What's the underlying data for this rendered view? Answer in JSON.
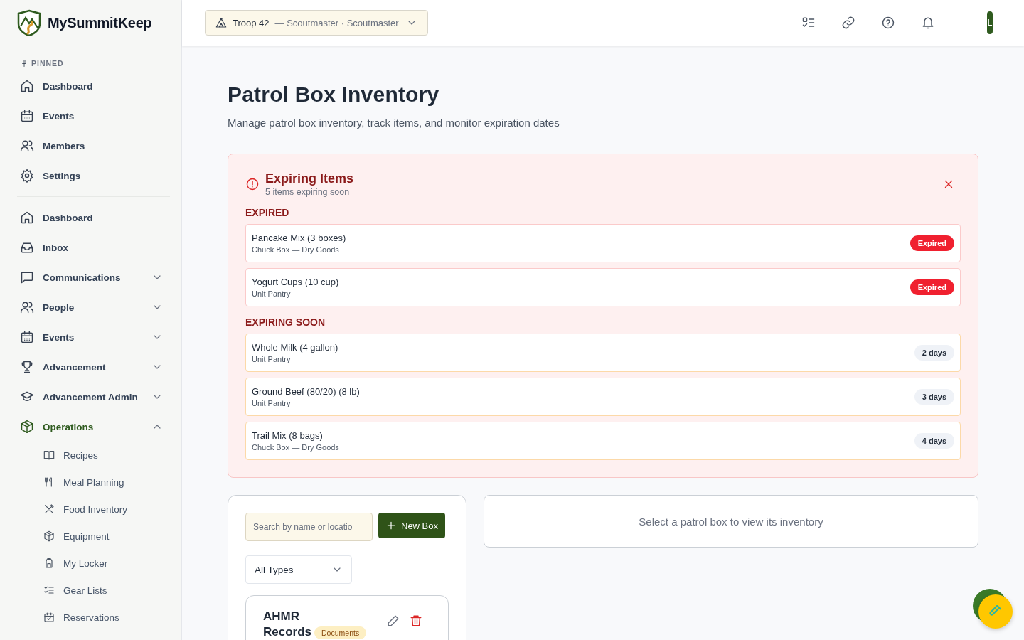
{
  "app": {
    "name": "MySummitKeep"
  },
  "unit_selector": {
    "unit": "Troop 42",
    "role": "— Scoutmaster · Scoutmaster"
  },
  "user": {
    "initial": "L"
  },
  "sidebar": {
    "pinned_label": "PINNED",
    "pinned": [
      {
        "label": "Dashboard"
      },
      {
        "label": "Events"
      },
      {
        "label": "Members"
      },
      {
        "label": "Settings"
      }
    ],
    "nav": [
      {
        "label": "Dashboard",
        "kind": "link"
      },
      {
        "label": "Inbox",
        "kind": "link"
      },
      {
        "label": "Communications",
        "kind": "group",
        "expanded": false
      },
      {
        "label": "People",
        "kind": "group",
        "expanded": false
      },
      {
        "label": "Events",
        "kind": "group",
        "expanded": false
      },
      {
        "label": "Advancement",
        "kind": "group",
        "expanded": false
      },
      {
        "label": "Advancement Admin",
        "kind": "group",
        "expanded": false
      },
      {
        "label": "Operations",
        "kind": "group",
        "expanded": true,
        "children": [
          {
            "label": "Recipes"
          },
          {
            "label": "Meal Planning"
          },
          {
            "label": "Food Inventory"
          },
          {
            "label": "Equipment"
          },
          {
            "label": "My Locker"
          },
          {
            "label": "Gear Lists"
          },
          {
            "label": "Reservations"
          }
        ]
      }
    ]
  },
  "page": {
    "title": "Patrol Box Inventory",
    "subtitle": "Manage patrol box inventory, track items, and monitor expiration dates"
  },
  "alert": {
    "title": "Expiring Items",
    "subtitle": "5 items expiring soon",
    "groups": [
      {
        "heading": "EXPIRED",
        "kind": "expired",
        "items": [
          {
            "name": "Pancake Mix (3 boxes)",
            "location": "Chuck Box — Dry Goods",
            "badge": "Expired"
          },
          {
            "name": "Yogurt Cups (10 cup)",
            "location": "Unit Pantry",
            "badge": "Expired"
          }
        ]
      },
      {
        "heading": "EXPIRING SOON",
        "kind": "soon",
        "items": [
          {
            "name": "Whole Milk (4 gallon)",
            "location": "Unit Pantry",
            "badge": "2 days"
          },
          {
            "name": "Ground Beef (80/20) (8 lb)",
            "location": "Unit Pantry",
            "badge": "3 days"
          },
          {
            "name": "Trail Mix (8 bags)",
            "location": "Chuck Box — Dry Goods",
            "badge": "4 days"
          }
        ]
      }
    ]
  },
  "boxes": {
    "search": {
      "placeholder": "Search by name or locatio"
    },
    "new_button": "New Box",
    "type_filter": {
      "value": "All Types"
    },
    "items": [
      {
        "name": "AHMR Records",
        "type": "Documents"
      }
    ]
  },
  "detail": {
    "empty_message": "Select a patrol box to view its inventory"
  }
}
